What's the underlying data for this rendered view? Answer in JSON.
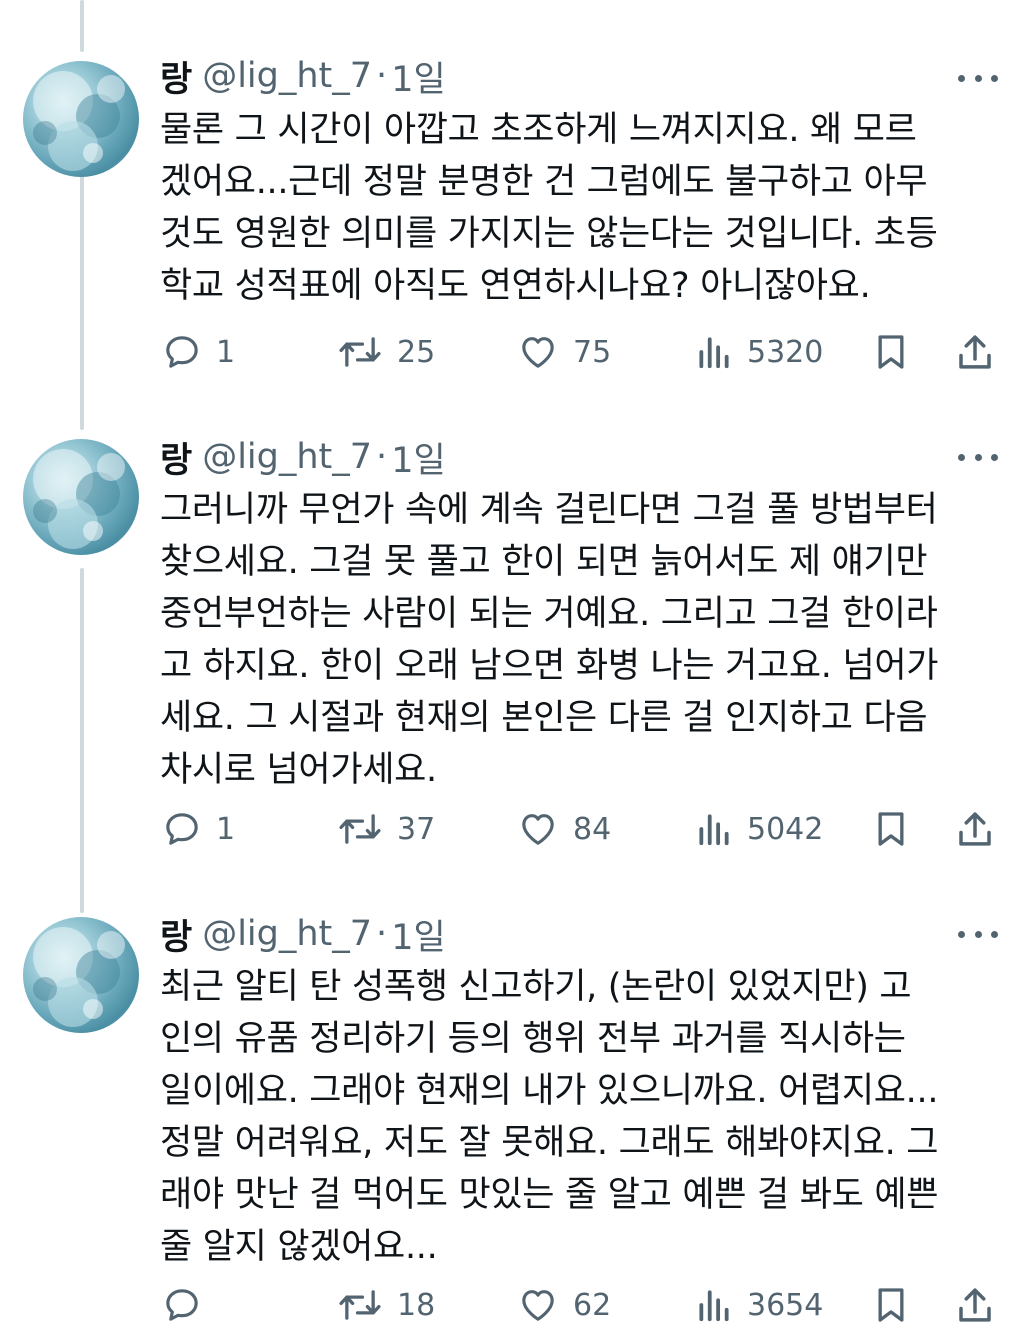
{
  "tweets": [
    {
      "name": "랑",
      "handle": "@lig_ht_7",
      "dot": "·",
      "time": "1일",
      "lines": [
        "물론 그 시간이 아깝고 초조하게 느껴지지요. 왜 모르",
        "겠어요...근데 정말 분명한 건 그럼에도 불구하고 아무",
        "것도 영원한 의미를 가지지는 않는다는 것입니다. 초등",
        "학교 성적표에 아직도 연연하시나요? 아니잖아요."
      ],
      "replies": "1",
      "retweets": "25",
      "likes": "75",
      "views": "5320"
    },
    {
      "name": "랑",
      "handle": "@lig_ht_7",
      "dot": "·",
      "time": "1일",
      "lines": [
        "그러니까 무언가 속에 계속 걸린다면 그걸 풀 방법부터",
        "찾으세요. 그걸 못 풀고 한이 되면 늙어서도 제 얘기만",
        "중언부언하는 사람이 되는 거예요. 그리고 그걸 한이라",
        "고 하지요. 한이 오래 남으면 화병 나는 거고요. 넘어가",
        "세요. 그 시절과 현재의 본인은 다른 걸 인지하고 다음",
        "차시로 넘어가세요."
      ],
      "replies": "1",
      "retweets": "37",
      "likes": "84",
      "views": "5042"
    },
    {
      "name": "랑",
      "handle": "@lig_ht_7",
      "dot": "·",
      "time": "1일",
      "lines": [
        "최근 알티 탄 성폭행 신고하기, (논란이 있었지만) 고",
        "인의 유품 정리하기 등의 행위 전부 과거를 직시하는",
        "일이에요. 그래야 현재의 내가 있으니까요. 어렵지요...",
        "정말 어려워요, 저도 잘 못해요. 그래도 해봐야지요. 그",
        "래야 맛난 걸 먹어도 맛있는 줄 알고 예쁜 걸 봐도 예쁜",
        "줄 알지 않겠어요..."
      ],
      "replies": "",
      "retweets": "18",
      "likes": "62",
      "views": "3654"
    }
  ],
  "icons": {
    "reply": "reply-icon",
    "retweet": "retweet-icon",
    "like": "heart-icon",
    "views": "views-icon",
    "bookmark": "bookmark-icon",
    "share": "share-icon",
    "more": "more-icon"
  },
  "colors": {
    "text": "#0f1419",
    "muted": "#536471",
    "thread_line": "#cfd9de"
  }
}
